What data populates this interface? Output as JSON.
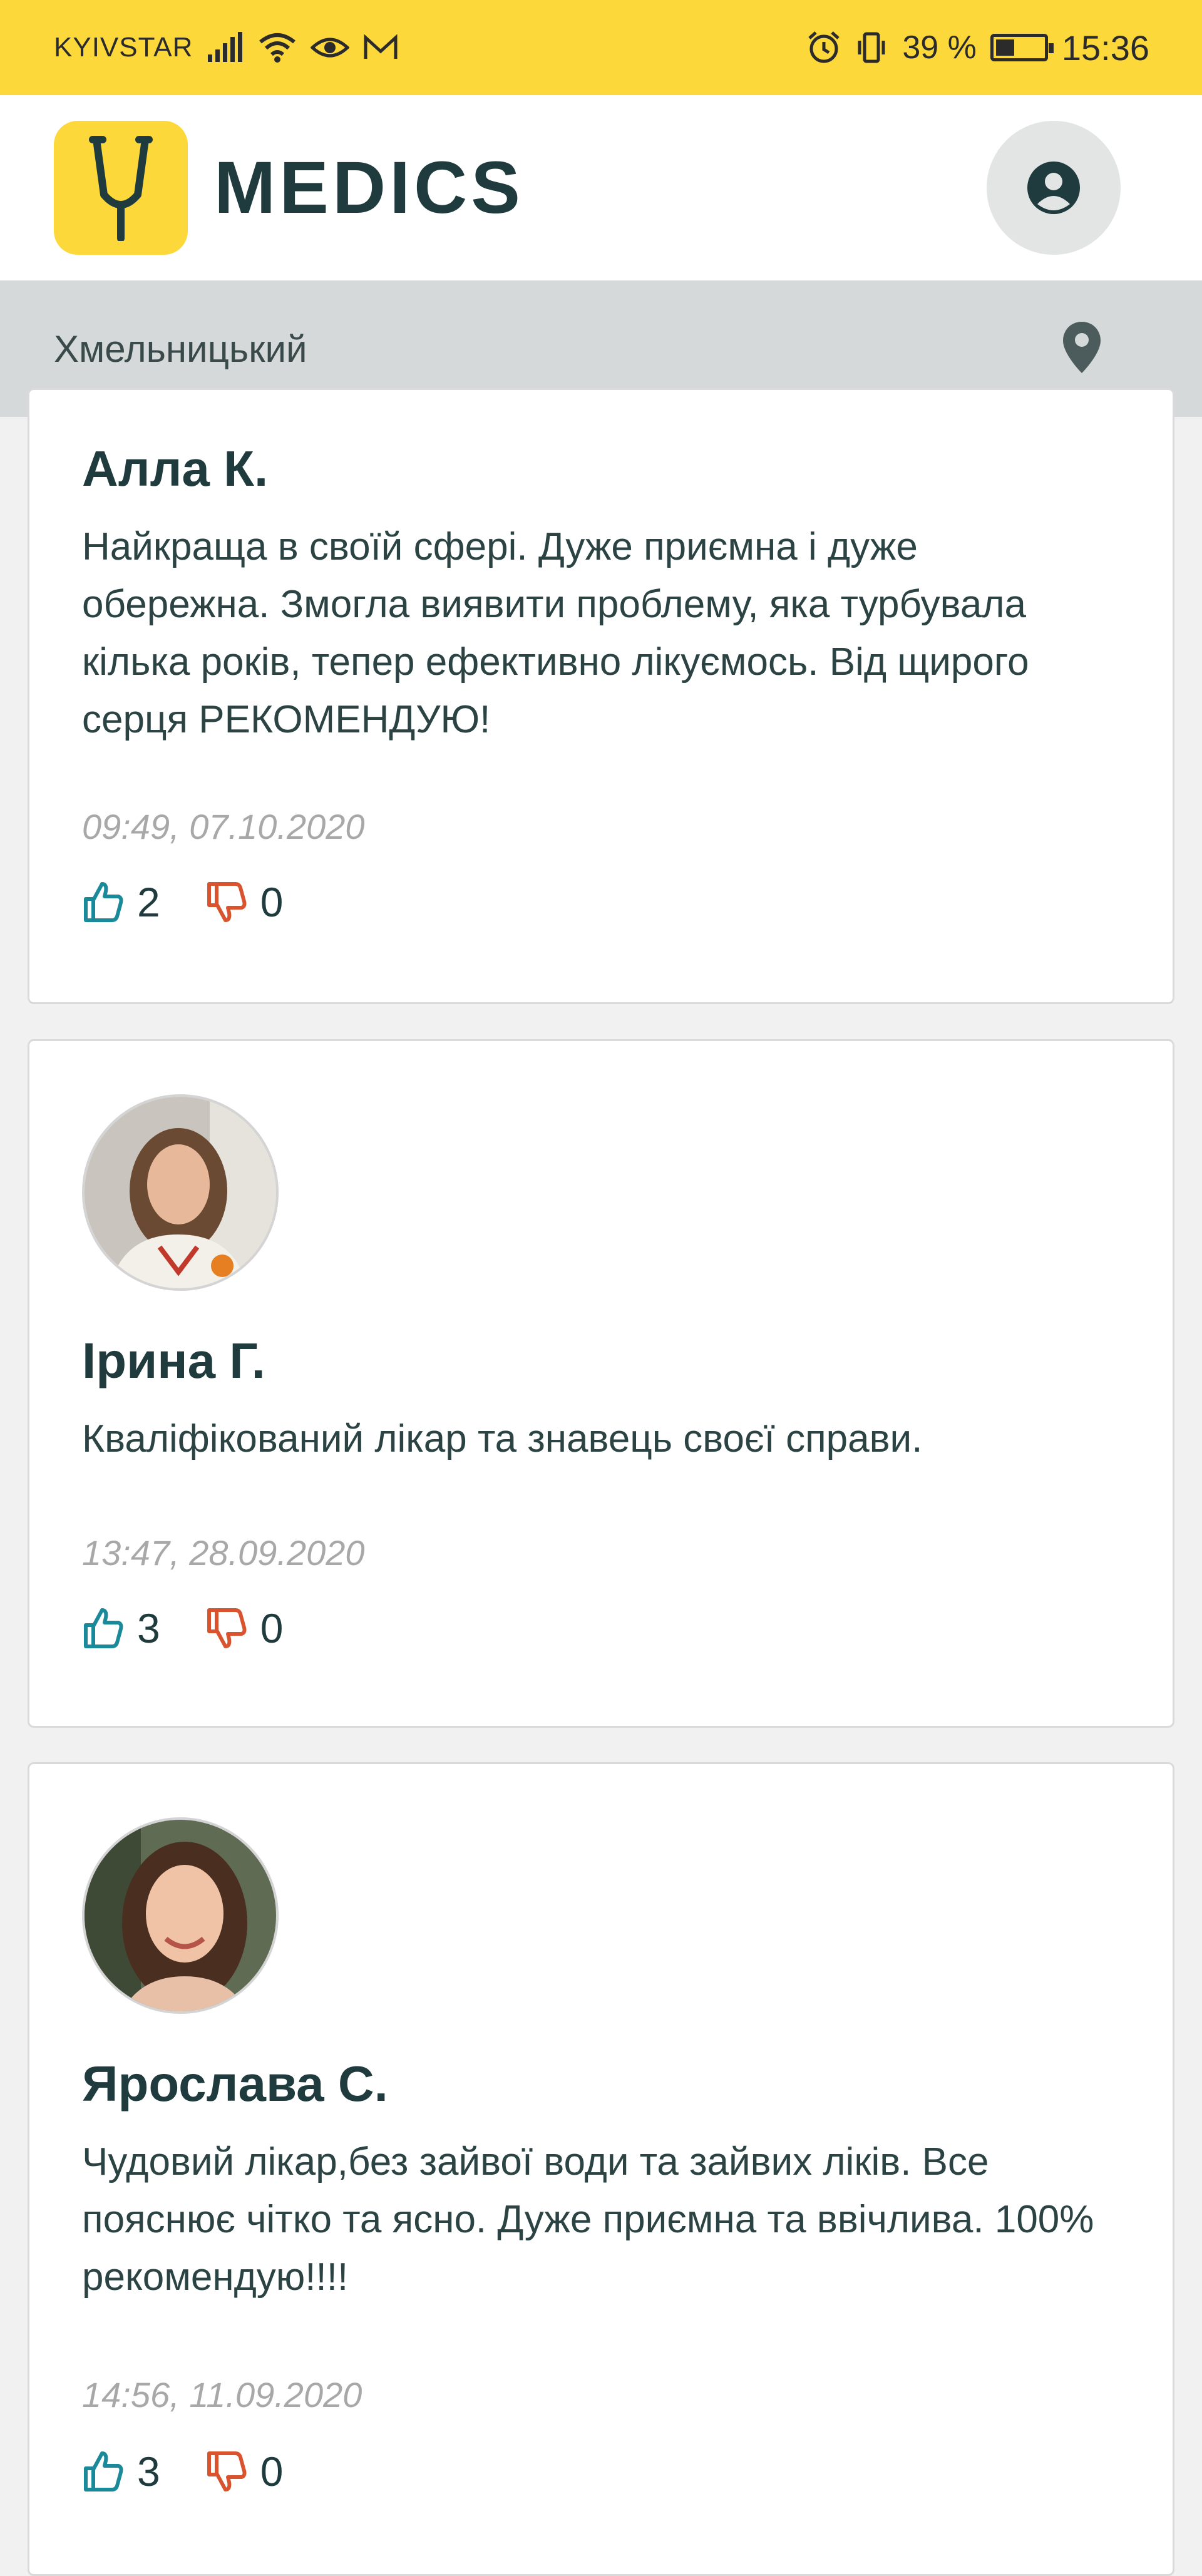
{
  "status_bar": {
    "carrier": "KYIVSTAR",
    "battery": "39 %",
    "time": "15:36"
  },
  "header": {
    "brand": "MEDICS",
    "accent": "#fdd83a"
  },
  "city_bar": {
    "city": "Хмельницький"
  },
  "reviews": [
    {
      "name": "Алла К.",
      "text": "Найкраща в своїй сфері. Дуже приємна і дуже обережна. Змогла виявити проблему, яка турбувала кілька років, тепер ефективно лікуємось. Від щирого серця РЕКОМЕНДУЮ!",
      "date": "09:49, 07.10.2020",
      "likes": "2",
      "dislikes": "0"
    },
    {
      "name": "Ірина Г.",
      "text": "Кваліфікований лікар та знавець своєї справи.",
      "date": "13:47, 28.09.2020",
      "likes": "3",
      "dislikes": "0"
    },
    {
      "name": "Ярослава С.",
      "text": "Чудовий лікар,без зайвої води та зайвих ліків. Все пояснює чітко та ясно. Дуже приємна та ввічлива. 100% рекомендую!!!!",
      "date": "14:56, 11.09.2020",
      "likes": "3",
      "dislikes": "0"
    }
  ],
  "colors": {
    "like": "#1a8a9a",
    "dislike": "#d9532f"
  }
}
